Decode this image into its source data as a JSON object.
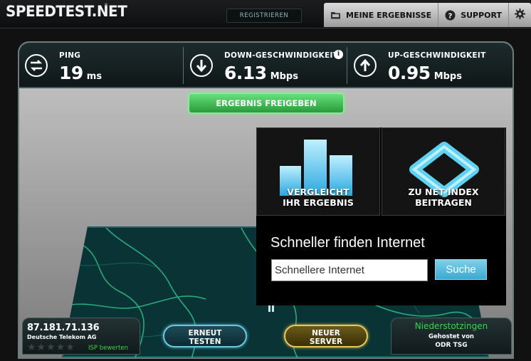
{
  "topbar": {
    "logo": "SPEEDTEST.NET",
    "logo_mark": "®",
    "register": "REGISTRIEREN",
    "nav": [
      {
        "label": "MEINE ERGEBNISSE",
        "icon": "folder-icon"
      },
      {
        "label": "SUPPORT",
        "icon": "question-icon"
      }
    ],
    "settings_icon": "gear-icon"
  },
  "stats": {
    "ping": {
      "label": "PING",
      "value": "19",
      "unit": "ms",
      "icon": "swap-arrows-icon"
    },
    "download": {
      "label": "DOWN-GESCHWINDIGKEIT",
      "value": "6.13",
      "unit": "Mbps",
      "icon": "arrow-down-icon",
      "info": "i"
    },
    "upload": {
      "label": "UP-GESCHWINDIGKEIT",
      "value": "0.95",
      "unit": "Mbps",
      "icon": "arrow-up-icon"
    }
  },
  "share_button": "ERGEBNIS FREIGEBEN",
  "popup": {
    "compare_line1": "VERGLEICHT",
    "compare_line2": "IHR ERGEBNIS",
    "netindex_line1": "ZU NET INDEX",
    "netindex_line2": "BEITRAGEN",
    "search_title": "Schneller finden Internet",
    "search_value": "Schnellere Internet",
    "search_button": "Suche"
  },
  "isp": {
    "ip": "87.181.71.136",
    "name": "Deutsche Telekom AG",
    "stars": "★★★★★",
    "rate_label": "ISP bewerten"
  },
  "buttons": {
    "retest_line1": "ERNEUT",
    "retest_line2": "TESTEN",
    "newserver_line1": "NEUER",
    "newserver_line2": "SERVER"
  },
  "server": {
    "city": "Niederstotzingen",
    "hosted_by": "Gehostet von",
    "host": "ODR TSG"
  },
  "colors": {
    "accent_green": "#38d44a",
    "accent_blue": "#3aa9d1",
    "accent_gold": "#e6c95a"
  }
}
